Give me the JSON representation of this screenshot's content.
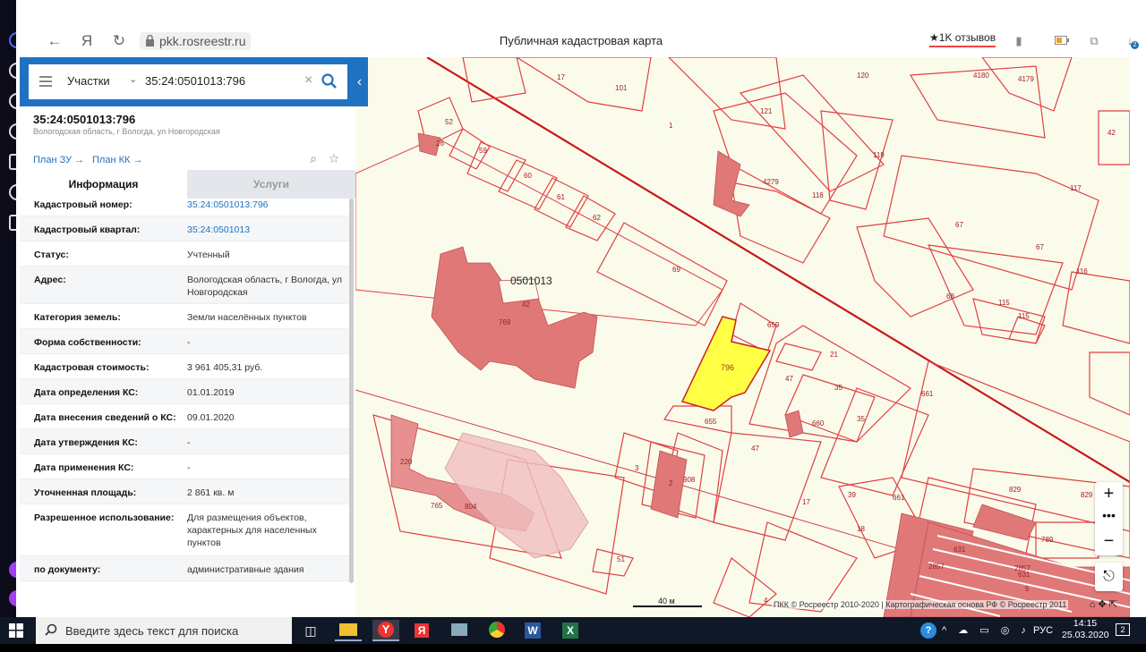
{
  "browser": {
    "url": "pkk.rosreestr.ru",
    "page_title": "Публичная кадастровая карта",
    "reviews_label": "1K отзывов",
    "download_badge": "2"
  },
  "search": {
    "type_label": "Участки",
    "query": "35:24:0501013:796"
  },
  "object": {
    "title": "35:24:0501013:796",
    "address_short": "Вологодская область, г Вологда, ул Новгородская",
    "plan_zu": "План ЗУ",
    "plan_kk": "План КК"
  },
  "tabs": {
    "info": "Информация",
    "services": "Услуги"
  },
  "info_rows": [
    {
      "key": "Кадастровый номер:",
      "value": "35:24:0501013:796"
    },
    {
      "key": "Кадастровый квартал:",
      "value": "35:24:0501013"
    },
    {
      "key": "Статус:",
      "value": "Учтенный"
    },
    {
      "key": "Адрес:",
      "value": "Вологодская область, г Вологда, ул Новгородская"
    },
    {
      "key": "Категория земель:",
      "value": "Земли населённых пунктов"
    },
    {
      "key": "Форма собственности:",
      "value": "-"
    },
    {
      "key": "Кадастровая стоимость:",
      "value": "3 961 405,31 руб."
    },
    {
      "key": "Дата определения КС:",
      "value": "01.01.2019"
    },
    {
      "key": "Дата внесения сведений о КС:",
      "value": "09.01.2020"
    },
    {
      "key": "Дата утверждения КС:",
      "value": "-"
    },
    {
      "key": "Дата применения КС:",
      "value": "-"
    },
    {
      "key": "Уточненная площадь:",
      "value": "2 861 кв. м"
    },
    {
      "key": "Разрешенное использование:",
      "value": "Для размещения объектов, характерных для населенных пунктов"
    },
    {
      "key": "по документу:",
      "value": "административные здания"
    }
  ],
  "map": {
    "quarter_label": "0501013",
    "selected_parcel": "796",
    "scale_label": "40 м",
    "attribution": "ПКК © Росреестр 2010-2020 | Картографическая основа РФ © Росреестр 2011",
    "parcel_labels": [
      "17",
      "101",
      "120",
      "4180",
      "4179",
      "42",
      "52",
      "26",
      "59",
      "60",
      "61",
      "62",
      "121",
      "4279",
      "118",
      "119",
      "117",
      "67",
      "67",
      "68",
      "115",
      "115",
      "116",
      "69",
      "42",
      "769",
      "659",
      "21",
      "47",
      "35",
      "35",
      "661",
      "655",
      "47",
      "3",
      "2",
      "908",
      "17",
      "661",
      "829",
      "829",
      "789",
      "631",
      "2857",
      "631",
      "2857",
      "5",
      "51",
      "4",
      "765",
      "804",
      "220",
      "660",
      "39",
      "18",
      "1"
    ],
    "selected_color": "#ffff44",
    "line_color": "#d02020",
    "building_color": "#e07878"
  },
  "taskbar": {
    "search_placeholder": "Введите здесь текст для поиска",
    "language": "РУС",
    "time": "14:15",
    "date": "25.03.2020",
    "notifications": "2"
  }
}
